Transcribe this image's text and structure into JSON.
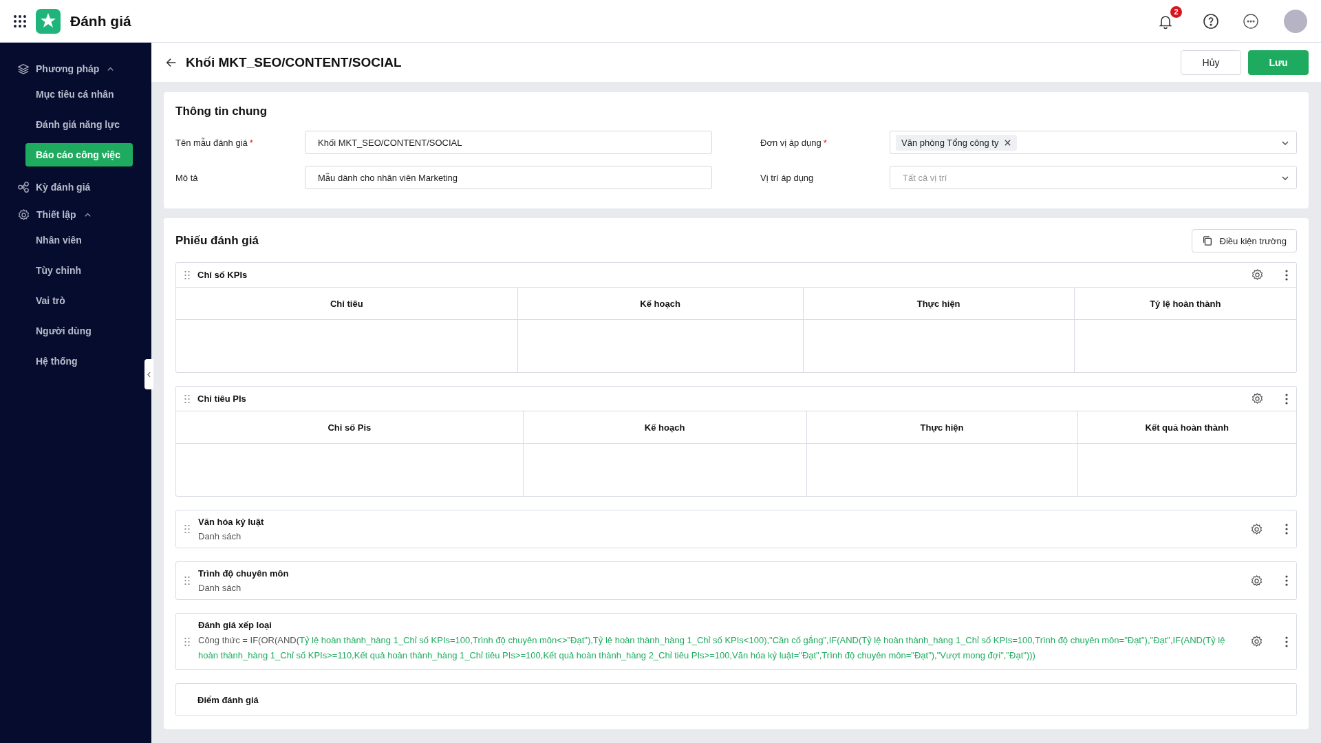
{
  "app": {
    "title": "Đánh giá"
  },
  "header": {
    "notification_count": "2"
  },
  "sidebar": {
    "groups": [
      {
        "label": "Phương pháp",
        "expanded": true,
        "items": [
          {
            "label": "Mục tiêu cá nhân",
            "selected": false
          },
          {
            "label": "Đánh giá năng lực",
            "selected": false
          },
          {
            "label": "Báo cáo công việc",
            "selected": true
          }
        ]
      },
      {
        "label": "Kỳ đánh giá"
      },
      {
        "label": "Thiết lập",
        "expanded": true,
        "items": [
          {
            "label": "Nhân viên",
            "selected": false
          },
          {
            "label": "Tùy chỉnh",
            "selected": false
          },
          {
            "label": "Vai trò",
            "selected": false
          },
          {
            "label": "Người dùng",
            "selected": false
          },
          {
            "label": "Hệ thống",
            "selected": false
          }
        ]
      }
    ]
  },
  "page": {
    "title": "Khối MKT_SEO/CONTENT/SOCIAL",
    "buttons": [
      {
        "label": "Hủy",
        "kind": "secondary"
      },
      {
        "label": "Lưu",
        "kind": "primary"
      }
    ]
  },
  "general": {
    "title": "Thông tin chung",
    "fields": [
      {
        "label": "Tên mẫu đánh giá",
        "required_mark": "*",
        "kind": "text",
        "value": "Khối MKT_SEO/CONTENT/SOCIAL"
      },
      {
        "label": "Đơn vị áp dụng",
        "required_mark": "*",
        "kind": "tags",
        "tags": [
          "Văn phòng Tổng công ty"
        ]
      },
      {
        "label": "Mô tả",
        "kind": "text",
        "value": "Mẫu dành cho nhân viên Marketing"
      },
      {
        "label": "Vị trí áp dụng",
        "kind": "select",
        "placeholder": "Tất cả vị trí"
      }
    ]
  },
  "form": {
    "title": "Phiếu đánh giá",
    "condition_button": "Điều kiện trường",
    "sections": [
      {
        "kind": "table",
        "title": "Chỉ số KPIs",
        "columns": [
          "Chỉ tiêu",
          "Kế hoạch",
          "Thực hiện",
          "Tỷ lệ hoàn thành"
        ]
      },
      {
        "kind": "table",
        "title": "Chỉ tiêu PIs",
        "columns": [
          "Chỉ số Pis",
          "Kế hoạch",
          "Thực hiện",
          "Kết quả hoàn thành"
        ]
      },
      {
        "kind": "list",
        "title": "Văn hóa kỷ luật",
        "subtitle": "Danh sách"
      },
      {
        "kind": "list",
        "title": "Trình độ chuyên môn",
        "subtitle": "Danh sách"
      },
      {
        "kind": "formula",
        "title": "Đánh giá xếp loại",
        "formula": [
          {
            "text": "Công thức = IF(OR(AND(",
            "highlight": false
          },
          {
            "text": "Tỷ lệ hoàn thành_hàng 1_Chỉ số KPIs=100,Trình độ chuyên môn<>\"Đạt\"),Tỷ lệ hoàn thành_hàng 1_Chỉ số KPIs<100),\"Cần cố gắng\",IF(AND(Tỷ lệ hoàn thành_hàng 1_Chỉ số KPIs=100,Trình độ chuyên môn=\"Đạt\"),\"Đạt\",IF(AND(Tỷ lệ hoàn thành_hàng 1_Chỉ số KPIs>=110,Kết quả hoàn thành_hàng 1_Chỉ tiêu PIs>=100,Kết quả hoàn thành_hàng 2_Chỉ tiêu PIs>=100,Văn hóa kỷ luật=\"Đạt\",Trình độ chuyên môn=\"Đạt\"),\"Vượt mong đợi\",\"Đạt\")))",
            "highlight": true
          }
        ]
      },
      {
        "kind": "header",
        "title": "Điểm đánh giá"
      }
    ]
  }
}
